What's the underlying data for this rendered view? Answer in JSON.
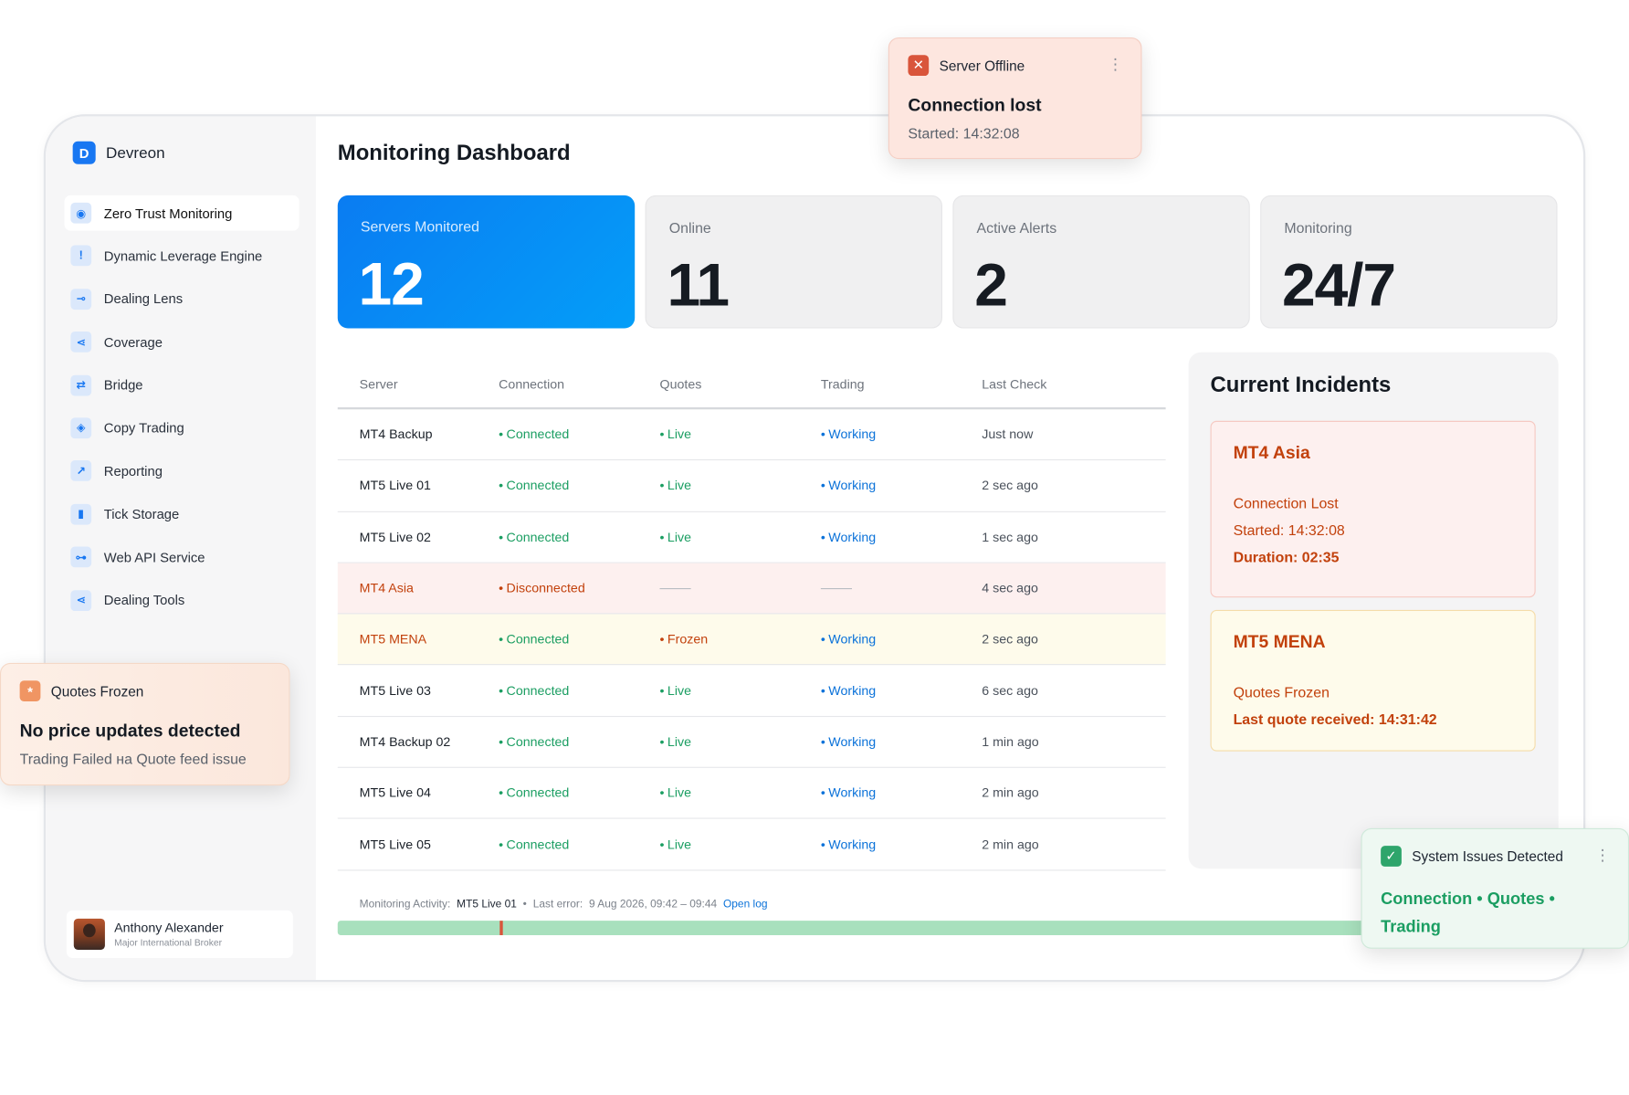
{
  "brand": {
    "name": "Devreon"
  },
  "sidebar": {
    "items": [
      {
        "label": "Zero Trust Monitoring",
        "icon": "eye-icon"
      },
      {
        "label": "Dynamic Leverage Engine",
        "icon": "alert-icon"
      },
      {
        "label": "Dealing Lens",
        "icon": "lens-icon"
      },
      {
        "label": "Coverage",
        "icon": "share-icon"
      },
      {
        "label": "Bridge",
        "icon": "bridge-icon"
      },
      {
        "label": "Copy Trading",
        "icon": "copy-icon"
      },
      {
        "label": "Reporting",
        "icon": "chart-icon"
      },
      {
        "label": "Tick Storage",
        "icon": "bars-icon"
      },
      {
        "label": "Web API Service",
        "icon": "api-icon"
      },
      {
        "label": "Dealing Tools",
        "icon": "tools-icon"
      }
    ]
  },
  "user": {
    "name": "Anthony Alexander",
    "role": "Major International Broker"
  },
  "page": {
    "title": "Monitoring Dashboard"
  },
  "stats": [
    {
      "label": "Servers Monitored",
      "value": "12"
    },
    {
      "label": "Online",
      "value": "11"
    },
    {
      "label": "Active Alerts",
      "value": "2"
    },
    {
      "label": "Monitoring",
      "value": "24/7"
    }
  ],
  "table": {
    "headers": [
      "Server",
      "Connection",
      "Quotes",
      "Trading",
      "Last Check"
    ],
    "rows": [
      {
        "server": "MT4 Backup",
        "connection": "Connected",
        "quotes": "Live",
        "trading": "Working",
        "last_check": "Just now"
      },
      {
        "server": "MT5 Live 01",
        "connection": "Connected",
        "quotes": "Live",
        "trading": "Working",
        "last_check": "2 sec ago"
      },
      {
        "server": "MT5 Live 02",
        "connection": "Connected",
        "quotes": "Live",
        "trading": "Working",
        "last_check": "1 sec ago"
      },
      {
        "server": "MT4 Asia",
        "connection": "Disconnected",
        "quotes": "",
        "trading": "",
        "last_check": "4 sec ago"
      },
      {
        "server": "MT5 MENA",
        "connection": "Connected",
        "quotes": "Frozen",
        "trading": "Working",
        "last_check": "2 sec ago"
      },
      {
        "server": "MT5 Live 03",
        "connection": "Connected",
        "quotes": "Live",
        "trading": "Working",
        "last_check": "6 sec ago"
      },
      {
        "server": "MT4 Backup 02",
        "connection": "Connected",
        "quotes": "Live",
        "trading": "Working",
        "last_check": "1 min ago"
      },
      {
        "server": "MT5 Live 04",
        "connection": "Connected",
        "quotes": "Live",
        "trading": "Working",
        "last_check": "2 min ago"
      },
      {
        "server": "MT5 Live 05",
        "connection": "Connected",
        "quotes": "Live",
        "trading": "Working",
        "last_check": "2 min ago"
      }
    ]
  },
  "activity": {
    "label": "Monitoring Activity:",
    "server": "MT5 Live 01",
    "sep": "•",
    "last_error": "Last error:",
    "range": "9 Aug 2026, 09:42 – 09:44",
    "link": "Open log"
  },
  "incidents": {
    "title": "Current Incidents",
    "cards": [
      {
        "name": "MT4 Asia",
        "lines": [
          "Connection Lost",
          "Started: 14:32:08",
          "Duration: 02:35"
        ]
      },
      {
        "name": "MT5 MENA",
        "lines": [
          "Quotes Frozen",
          "Last quote received: 14:31:42"
        ]
      }
    ]
  },
  "toasts": {
    "offline": {
      "head": "Server Offline",
      "title": "Connection lost",
      "sub": "Started: 14:32:08",
      "icon": "close-icon"
    },
    "frozen": {
      "head": "Quotes Frozen",
      "title": "No price updates detected",
      "sub": "Trading Failed на Quote feed issue",
      "icon": "asterisk-icon"
    },
    "issues": {
      "head": "System Issues Detected",
      "text": "Connection  •  Quotes  •  Trading",
      "icon": "check-icon"
    }
  },
  "colors": {
    "accent": "#1877f2",
    "ok": "#1b9e62",
    "warn": "#c2410c",
    "info": "#0b72d9"
  }
}
